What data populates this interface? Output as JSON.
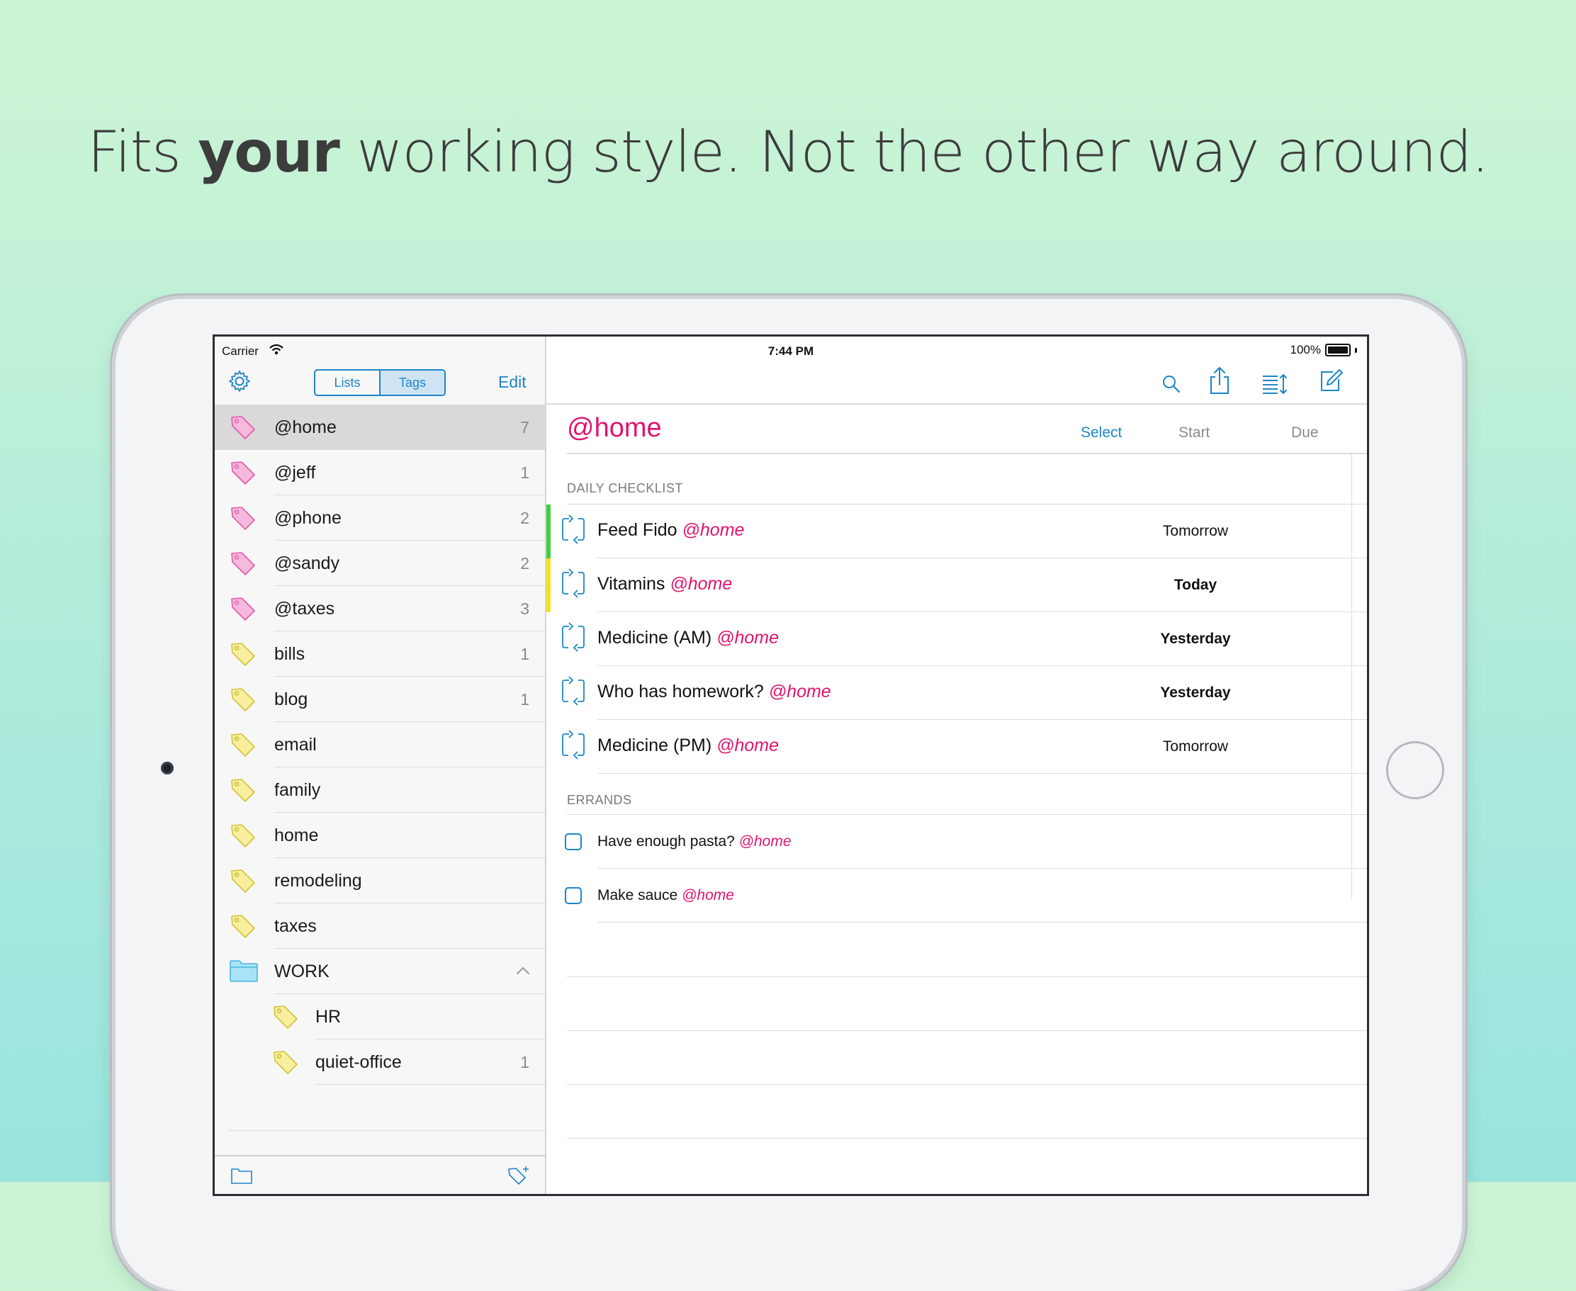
{
  "headline": {
    "pre": "Fits ",
    "bold": "your",
    "post": " working style. Not the other way around."
  },
  "status": {
    "carrier": "Carrier",
    "time": "7:44 PM",
    "battery": "100%"
  },
  "sidebar": {
    "segments": [
      {
        "label": "Lists",
        "selected": false
      },
      {
        "label": "Tags",
        "selected": true
      }
    ],
    "edit_label": "Edit",
    "items": [
      {
        "label": "@home",
        "count": "7",
        "type": "context",
        "selected": true
      },
      {
        "label": "@jeff",
        "count": "1",
        "type": "context"
      },
      {
        "label": "@phone",
        "count": "2",
        "type": "context"
      },
      {
        "label": "@sandy",
        "count": "2",
        "type": "context"
      },
      {
        "label": "@taxes",
        "count": "3",
        "type": "context"
      },
      {
        "label": "bills",
        "count": "1",
        "type": "tag"
      },
      {
        "label": "blog",
        "count": "1",
        "type": "tag"
      },
      {
        "label": "email",
        "count": "",
        "type": "tag"
      },
      {
        "label": "family",
        "count": "",
        "type": "tag"
      },
      {
        "label": "home",
        "count": "",
        "type": "tag"
      },
      {
        "label": "remodeling",
        "count": "",
        "type": "tag"
      },
      {
        "label": "taxes",
        "count": "",
        "type": "tag"
      },
      {
        "label": "WORK",
        "count": "",
        "type": "folder"
      },
      {
        "label": "HR",
        "count": "",
        "type": "tag",
        "child": true
      },
      {
        "label": "quiet-office",
        "count": "1",
        "type": "tag",
        "child": true
      }
    ]
  },
  "main": {
    "list_title": "@home",
    "columns": {
      "select": "Select",
      "start": "Start",
      "due": "Due"
    },
    "sections": [
      {
        "name": "DAILY CHECKLIST",
        "tasks": [
          {
            "title": "Feed Fido",
            "tag": "@home",
            "start": "Tomorrow",
            "start_bold": false,
            "flag": "#3fd23f",
            "repeat": true
          },
          {
            "title": "Vitamins",
            "tag": "@home",
            "start": "Today",
            "start_bold": true,
            "flag": "#f2e21a",
            "repeat": true
          },
          {
            "title": "Medicine (AM)",
            "tag": "@home",
            "start": "Yesterday",
            "start_bold": true,
            "flag": "",
            "repeat": true
          },
          {
            "title": "Who has homework?",
            "tag": "@home",
            "start": "Yesterday",
            "start_bold": true,
            "flag": "",
            "repeat": true
          },
          {
            "title": "Medicine (PM)",
            "tag": "@home",
            "start": "Tomorrow",
            "start_bold": false,
            "flag": "",
            "repeat": true
          }
        ]
      },
      {
        "name": "ERRANDS",
        "tasks": [
          {
            "title": "Have enough pasta?",
            "tag": "@home",
            "start": "",
            "start_bold": false,
            "flag": "",
            "repeat": false
          },
          {
            "title": "Make sauce",
            "tag": "@home",
            "start": "",
            "start_bold": false,
            "flag": "",
            "repeat": false
          }
        ]
      }
    ]
  },
  "colors": {
    "accent": "#1d86c8",
    "context_tag": "#e0136e",
    "tag_pink": "#f6b9de",
    "tag_yellow": "#f7ef9e",
    "folder": "#a8e3f6"
  }
}
